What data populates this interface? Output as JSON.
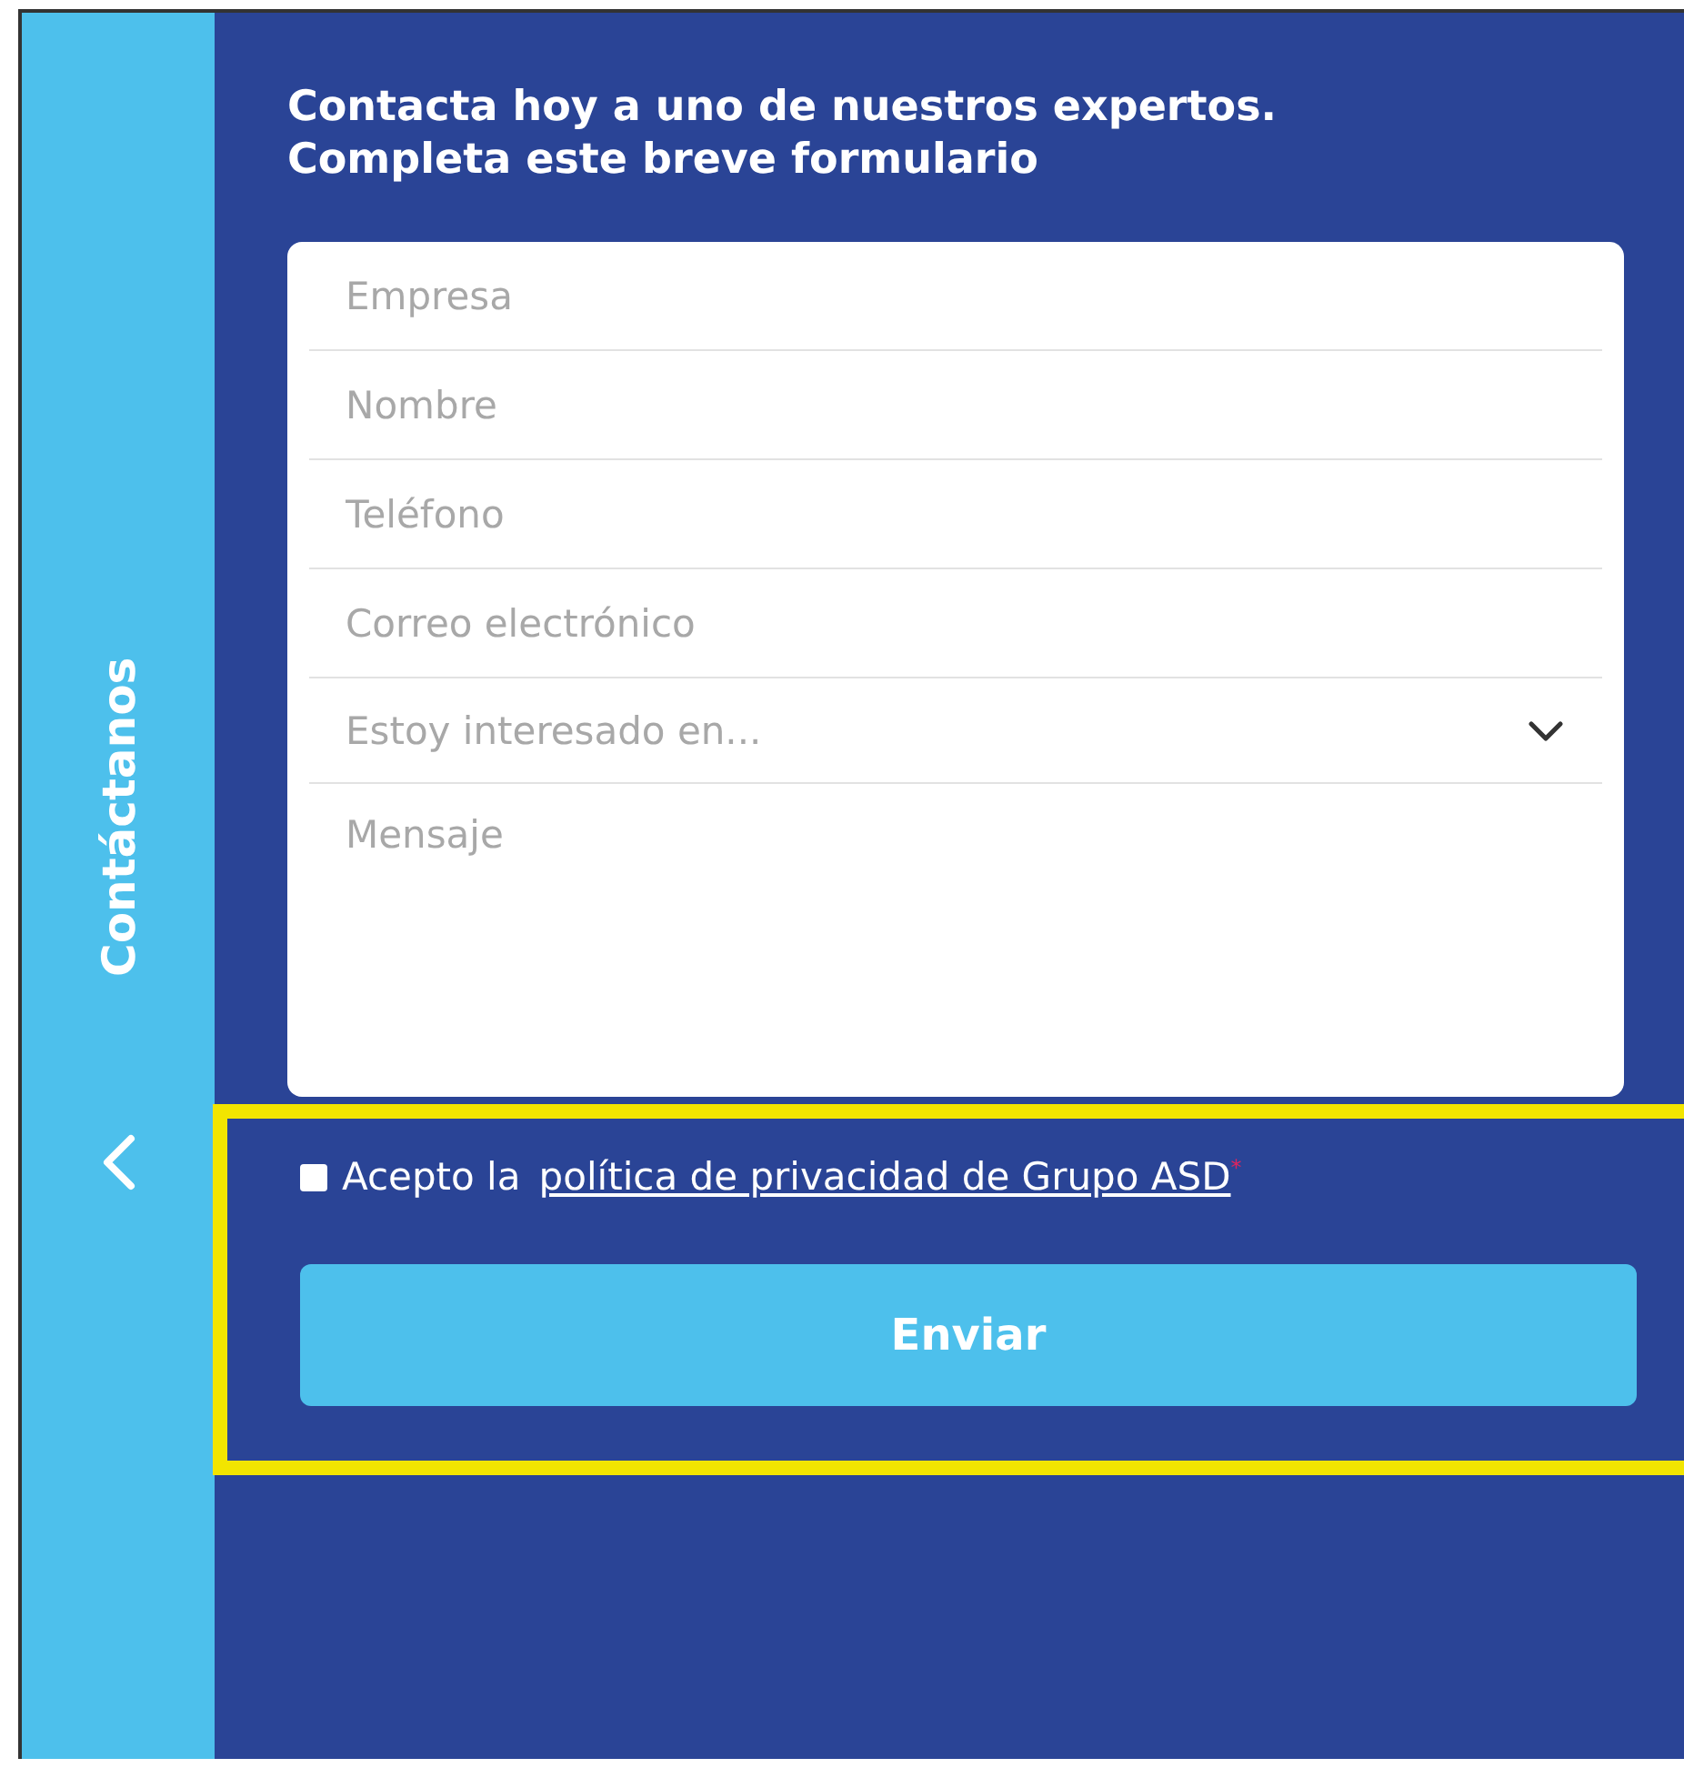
{
  "sidebar": {
    "label": "Contáctanos"
  },
  "heading": {
    "lines": [
      "Contacta hoy a uno de nuestros expertos.",
      "Completa este breve formulario"
    ]
  },
  "form": {
    "fields": [
      {
        "kind": "text",
        "placeholder": "Empresa"
      },
      {
        "kind": "text",
        "placeholder": "Nombre"
      },
      {
        "kind": "text",
        "placeholder": "Teléfono"
      },
      {
        "kind": "text",
        "placeholder": "Correo electrónico"
      },
      {
        "kind": "select",
        "placeholder": "Estoy interesado en..."
      },
      {
        "kind": "textarea",
        "placeholder": "Mensaje"
      }
    ]
  },
  "consent": {
    "highlighted": true,
    "checked": false,
    "prefix": "Acepto la",
    "link": "política de privacidad de Grupo ASD",
    "required_mark": "*"
  },
  "submit": {
    "label": "Enviar"
  }
}
